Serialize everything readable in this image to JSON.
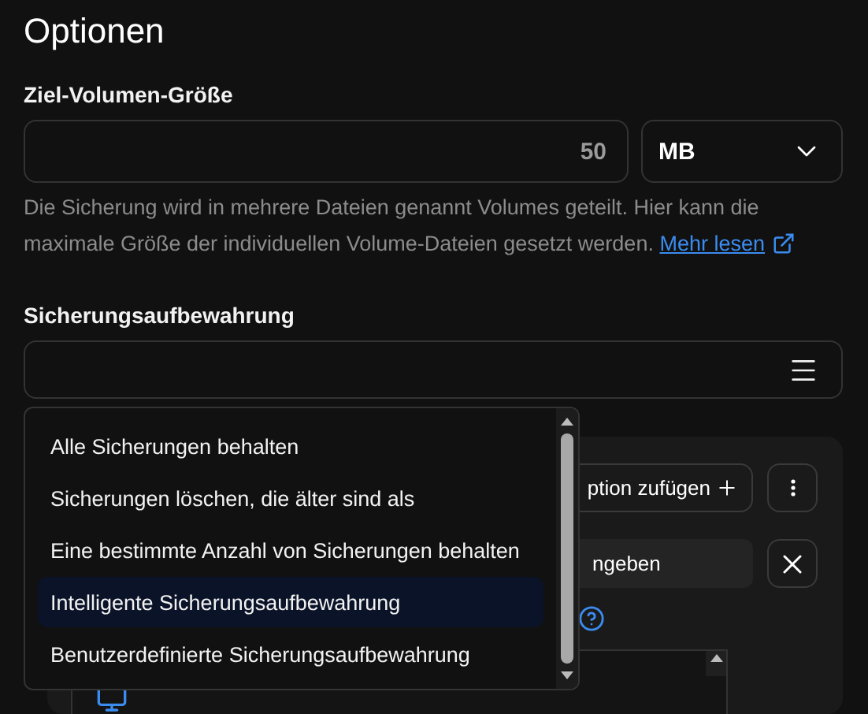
{
  "title": "Optionen",
  "volume_size": {
    "label": "Ziel-Volumen-Größe",
    "value": "50",
    "unit": "MB",
    "help": "Die Sicherung wird in mehrere Dateien genannt Volumes geteilt. Hier kann die maximale Größe der individuellen Volume-Dateien gesetzt werden.",
    "link": "Mehr lesen"
  },
  "retention": {
    "label": "Sicherungsaufbewahrung",
    "options": [
      {
        "label": "Alle Sicherungen behalten",
        "selected": false
      },
      {
        "label": "Sicherungen löschen, die älter sind als",
        "selected": false
      },
      {
        "label": "Eine bestimmte Anzahl von Sicherungen behalten",
        "selected": false
      },
      {
        "label": "Intelligente Sicherungsaufbewahrung",
        "selected": true
      },
      {
        "label": "Benutzerdefinierte Sicherungsaufbewahrung",
        "selected": false
      }
    ]
  },
  "panel": {
    "add_button": "ption zufügen",
    "field_value": "ngeben"
  }
}
